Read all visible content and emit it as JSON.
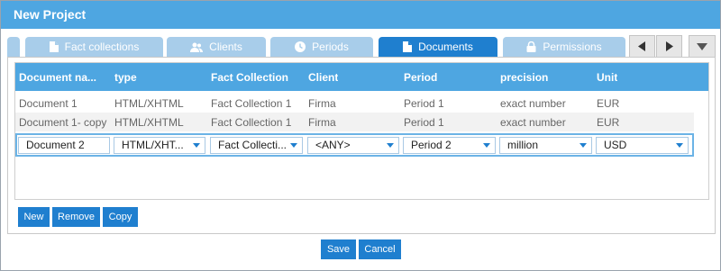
{
  "window": {
    "title": "New Project"
  },
  "tabs": [
    {
      "label": "Fact collections",
      "icon": "document-icon",
      "active": false
    },
    {
      "label": "Clients",
      "icon": "users-icon",
      "active": false
    },
    {
      "label": "Periods",
      "icon": "clock-icon",
      "active": false
    },
    {
      "label": "Documents",
      "icon": "document-icon",
      "active": true
    },
    {
      "label": "Permissions",
      "icon": "lock-icon",
      "active": false
    }
  ],
  "tab_nav": {
    "prev": "◀",
    "next": "▶",
    "menu": "▼"
  },
  "grid": {
    "columns": [
      "Document na...",
      "type",
      "Fact Collection",
      "Client",
      "Period",
      "precision",
      "Unit"
    ],
    "rows": [
      [
        "Document 1",
        "HTML/XHTML",
        "Fact Collection 1",
        "Firma",
        "Period 1",
        "exact number",
        "EUR"
      ],
      [
        "Document 1- copy",
        "HTML/XHTML",
        "Fact Collection 1",
        "Firma",
        "Period 1",
        "exact number",
        "EUR"
      ]
    ],
    "edit_row": {
      "document_name": "Document 2",
      "type": "HTML/XHT...",
      "fact_collection": "Fact Collecti...",
      "client": "<ANY>",
      "period": "Period 2",
      "precision": "million",
      "unit": "USD"
    }
  },
  "actions": {
    "new": "New",
    "remove": "Remove",
    "copy": "Copy"
  },
  "footer": {
    "save": "Save",
    "cancel": "Cancel"
  },
  "colors": {
    "titlebar": "#4ea6e1",
    "tab_active": "#1f7fcf",
    "tab_inactive": "#a8cdea",
    "button": "#1f7fcf"
  }
}
